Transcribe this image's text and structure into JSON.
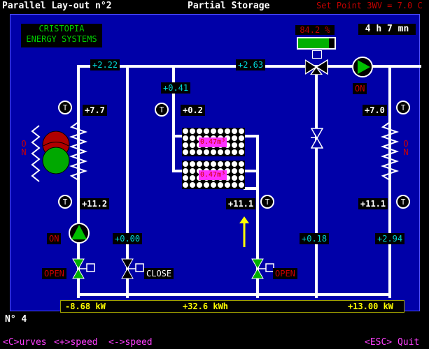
{
  "header": {
    "title": "Parallel Lay-out n°2",
    "mode": "Partial Storage",
    "setpoint": "Set Point 3WV = 7.0 C"
  },
  "logo": {
    "line1": "CRISTOPIA",
    "line2": "ENERGY  SYSTEMS"
  },
  "status": {
    "charge": "84.2 %",
    "charge_fraction": 0.842,
    "timer": "4 h  7 mn"
  },
  "values": {
    "flow_top_left": "+2.22",
    "flow_top_right": "+2.63",
    "flow_tank_in": "+0.41",
    "flow_bypass": "+0.00",
    "flow_middle_right": "+0.18",
    "flow_right": "+2.94",
    "temp_left_top": "+7.7",
    "temp_tank_in": "+0.2",
    "temp_right_top": "+7.0",
    "temp_left_bottom": "+11.2",
    "temp_tank_out": "+11.1",
    "temp_right_bottom": "+11.1"
  },
  "tanks": {
    "upper_volume": "0.47m³",
    "lower_volume": "0.47m³"
  },
  "states": {
    "chiller_left": "ON",
    "chiller_right": "ON",
    "pump_left": "ON",
    "pump_right": "ON",
    "valve_left": "OPEN",
    "valve_middle": "CLOSE",
    "valve_tank": "OPEN"
  },
  "footer_bar": {
    "power_left": "-8.68 kW",
    "energy": "+32.6 kWh",
    "power_right": "+13.00 kW"
  },
  "screen_number": "N° 4",
  "menu": {
    "curves": "<C>urves",
    "speed_up": "<+>speed",
    "speed_down": "<->speed",
    "quit": "<ESC> Quit"
  },
  "colors": {
    "panel": "#0000a8",
    "pipe": "#ffffff",
    "cyan_value": "#00d8d8",
    "red_text": "#d00000",
    "green": "#00b000",
    "magenta": "#ff30ff",
    "arrow": "#ffff00"
  }
}
